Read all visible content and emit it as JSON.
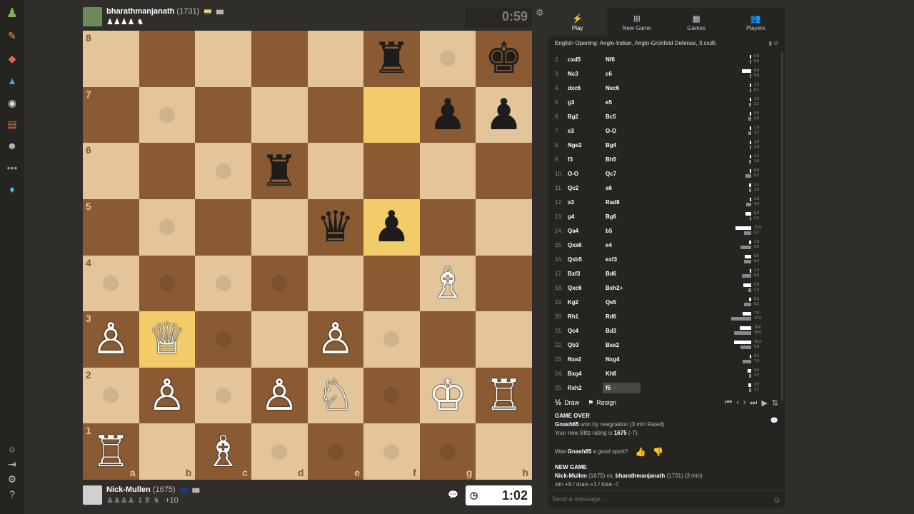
{
  "sidebar": {
    "icons": [
      "pawn-icon",
      "puzzle-icon",
      "lessons-icon",
      "learn-icon",
      "watch-icon",
      "news-icon",
      "social-icon",
      "more-icon",
      "diamond-icon"
    ],
    "bottom_icons": [
      "theme-icon",
      "logout-icon",
      "settings-icon",
      "help-icon"
    ]
  },
  "top_player": {
    "name": "bharathmanjanath",
    "rating": "(1731)",
    "captured": "♟♟♟♟ ♞",
    "clock": "0:59"
  },
  "bottom_player": {
    "name": "Nick-Mullen",
    "rating": "(1675)",
    "captured": "♟♟♟♟ ♝♜ ♞",
    "advantage": "+10",
    "clock": "1:02"
  },
  "board": {
    "ranks": [
      "8",
      "7",
      "6",
      "5",
      "4",
      "3",
      "2",
      "1"
    ],
    "files": [
      "a",
      "b",
      "c",
      "d",
      "e",
      "f",
      "g",
      "h"
    ],
    "pieces": [
      [
        "",
        "",
        "",
        "",
        "",
        "♜",
        "",
        "♚"
      ],
      [
        "",
        "",
        "",
        "",
        "",
        "",
        "♟",
        "♟"
      ],
      [
        "",
        "",
        "",
        "♜",
        "",
        "",
        "",
        ""
      ],
      [
        "",
        "",
        "",
        "",
        "♛",
        "♟",
        "",
        ""
      ],
      [
        "",
        "",
        "",
        "",
        "",
        "",
        "♗",
        ""
      ],
      [
        "♙",
        "♕",
        "",
        "",
        "♙",
        "",
        "",
        ""
      ],
      [
        "",
        "♙",
        "",
        "♙",
        "♘",
        "",
        "♔",
        "♖"
      ],
      [
        "♖",
        "",
        "♗",
        "",
        "",
        "",
        "",
        ""
      ]
    ],
    "colors": [
      [
        "",
        "",
        "",
        "",
        "",
        "b",
        "",
        "b"
      ],
      [
        "",
        "",
        "",
        "",
        "",
        "",
        "b",
        "b"
      ],
      [
        "",
        "",
        "",
        "b",
        "",
        "",
        "",
        ""
      ],
      [
        "",
        "",
        "",
        "",
        "b",
        "b",
        "",
        ""
      ],
      [
        "",
        "",
        "",
        "",
        "",
        "",
        "w",
        ""
      ],
      [
        "w",
        "w",
        "",
        "",
        "w",
        "",
        "",
        ""
      ],
      [
        "",
        "w",
        "",
        "w",
        "w",
        "",
        "w",
        "w"
      ],
      [
        "w",
        "",
        "w",
        "",
        "",
        "",
        "",
        ""
      ]
    ],
    "highlights": [
      "f7",
      "f5",
      "b3"
    ],
    "dots": [
      "g8",
      "b7",
      "c6",
      "b5",
      "a4",
      "b4",
      "c4",
      "d4",
      "c3",
      "f3",
      "a2",
      "c2",
      "f2",
      "a1",
      "d1",
      "e1",
      "f1",
      "g1"
    ]
  },
  "panel": {
    "tabs": [
      {
        "label": "Play",
        "icon": "⚡"
      },
      {
        "label": "New Game",
        "icon": "⊞"
      },
      {
        "label": "Games",
        "icon": "▦"
      },
      {
        "label": "Players",
        "icon": "👥"
      }
    ],
    "opening": "English Opening: Anglo-Indian, Anglo-Grünfeld Defense, 3.cxd5",
    "moves": [
      {
        "n": "2.",
        "w": "cxd5",
        "b": "Nf6",
        "t1": "0.9",
        "t2": "0.9"
      },
      {
        "n": "3.",
        "w": "Nc3",
        "b": "c6",
        "t1": "8.4",
        "t2": "0.9"
      },
      {
        "n": "4.",
        "w": "dxc6",
        "b": "Nxc6",
        "t1": "1.5",
        "t2": "0.1"
      },
      {
        "n": "5.",
        "w": "g3",
        "b": "e5",
        "t1": "1.0",
        "t2": "2.1"
      },
      {
        "n": "6.",
        "w": "Bg2",
        "b": "Bc5",
        "t1": "0.5",
        "t2": "2.8"
      },
      {
        "n": "7.",
        "w": "e3",
        "b": "O-O",
        "t1": "1.0",
        "t2": "2.7"
      },
      {
        "n": "8.",
        "w": "Nge2",
        "b": "Bg4",
        "t1": "1.0",
        "t2": "1.6"
      },
      {
        "n": "9.",
        "w": "f3",
        "b": "Bh5",
        "t1": "1.1",
        "t2": "1.8"
      },
      {
        "n": "10.",
        "w": "O-O",
        "b": "Qc7",
        "t1": "0.8",
        "t2": "5.1"
      },
      {
        "n": "11.",
        "w": "Qc2",
        "b": "a6",
        "t1": "2.1",
        "t2": "2.0"
      },
      {
        "n": "12.",
        "w": "a3",
        "b": "Rad8",
        "t1": "1.2",
        "t2": "4.4"
      },
      {
        "n": "13.",
        "w": "g4",
        "b": "Bg6",
        "t1": "5.2",
        "t2": "1.5"
      },
      {
        "n": "14.",
        "w": "Qa4",
        "b": "b5",
        "t1": "13.9",
        "t2": "6.3"
      },
      {
        "n": "15.",
        "w": "Qxa6",
        "b": "e4",
        "t1": "1.9",
        "t2": "9.5"
      },
      {
        "n": "16.",
        "w": "Qxb5",
        "b": "exf3",
        "t1": "6.0",
        "t2": "6.4"
      },
      {
        "n": "17.",
        "w": "Bxf3",
        "b": "Bd6",
        "t1": "1.4",
        "t2": "8.5"
      },
      {
        "n": "18.",
        "w": "Qxc6",
        "b": "Bxh2+",
        "t1": "6.9",
        "t2": "2.3"
      },
      {
        "n": "19.",
        "w": "Kg2",
        "b": "Qe5",
        "t1": "2.2",
        "t2": "6.2"
      },
      {
        "n": "20.",
        "w": "Rh1",
        "b": "Rd6",
        "t1": "7.6",
        "t2": "17.9"
      },
      {
        "n": "21.",
        "w": "Qc4",
        "b": "Bd3",
        "t1": "10.6",
        "t2": "15.5"
      },
      {
        "n": "22.",
        "w": "Qb3",
        "b": "Bxe2",
        "t1": "15.3",
        "t2": "9.9"
      },
      {
        "n": "23.",
        "w": "Nxe2",
        "b": "Nxg4",
        "t1": "0.1",
        "t2": "7.9"
      },
      {
        "n": "24.",
        "w": "Bxg4",
        "b": "Kh8",
        "t1": "3.5",
        "t2": "1.7"
      },
      {
        "n": "25.",
        "w": "Rxh2",
        "b": "f5",
        "t1": "2.9",
        "t2": "2.1"
      }
    ],
    "draw_label": "Draw",
    "draw_icon": "½",
    "resign_label": "Resign",
    "game_over": "GAME OVER",
    "result_winner": "Gnash85",
    "result_text": " won by resignation (3 min Rated)",
    "rating_text": "Your new Blitz rating is ",
    "rating_value": "1675",
    "rating_delta": " (-7).",
    "sport_q_pre": "Was ",
    "sport_q_name": "Gnash85",
    "sport_q_post": " a good sport?",
    "new_game": "NEW GAME",
    "ng_white": "Nick-Mullen",
    "ng_white_rating": " (1675) vs. ",
    "ng_black": "bharathmanjanath",
    "ng_black_rating": " (1731) (3 min)",
    "ng_stakes": "win +9 / draw +1 / lose -7",
    "message_placeholder": "Send a message..."
  }
}
